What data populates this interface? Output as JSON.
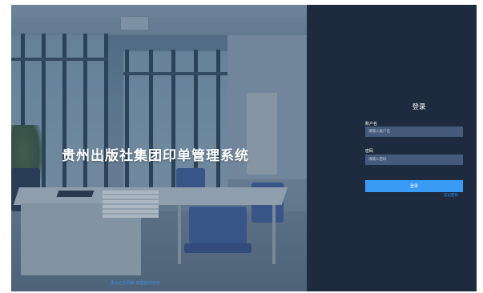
{
  "photo": {
    "system_title": "贵州出版社集团印单管理系统",
    "footer_text": "贵州之乐网络 数据提供支持"
  },
  "login": {
    "title": "登录",
    "username_label": "账户名",
    "username_placeholder": "请输入账户名",
    "password_label": "密码",
    "password_placeholder": "请输入密码",
    "submit_label": "登录",
    "forgot_label": "忘记密码"
  },
  "colors": {
    "panel_bg": "#1e2a3d",
    "input_bg": "#465a7b",
    "accent": "#3a9bf6"
  }
}
